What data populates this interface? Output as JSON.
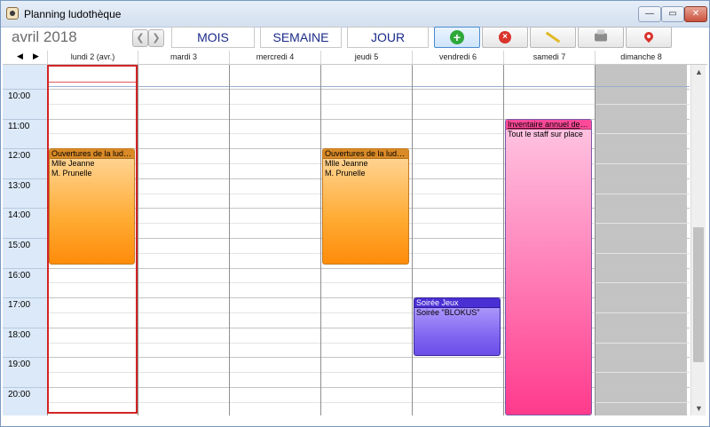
{
  "window": {
    "title": "Planning ludothèque",
    "controls": {
      "minimize": "—",
      "maximize": "▭",
      "close": "✕"
    }
  },
  "toolbar": {
    "month": "avril 2018",
    "prev_label": "❮",
    "next_label": "❯",
    "views": {
      "month": "MOIS",
      "week": "SEMAINE",
      "day": "JOUR"
    },
    "actions": {
      "add": {
        "icon": "add-circle-icon",
        "glyph": "+"
      },
      "delete": {
        "icon": "delete-circle-icon",
        "glyph": "×"
      },
      "edit": {
        "icon": "pencil-icon"
      },
      "print": {
        "icon": "printer-icon"
      },
      "locate": {
        "icon": "map-pin-icon"
      }
    }
  },
  "calendar": {
    "nav": {
      "prev": "◀",
      "next": "▶"
    },
    "days": [
      "lundi 2 (avr.)",
      "mardi 3",
      "mercredi 4",
      "jeudi 5",
      "vendredi 6",
      "samedi 7",
      "dimanche 8"
    ],
    "hours": [
      "10:00",
      "11:00",
      "12:00",
      "13:00",
      "14:00",
      "15:00",
      "16:00",
      "17:00",
      "18:00",
      "19:00",
      "20:00"
    ],
    "today_index": 0,
    "events": [
      {
        "day": 0,
        "start": 12.0,
        "end": 15.9,
        "title": "Ouvertures de la ludot...",
        "lines": [
          "Mlle Jeanne",
          "M. Prunelle"
        ],
        "color": "orange"
      },
      {
        "day": 3,
        "start": 12.0,
        "end": 15.9,
        "title": "Ouvertures de la ludot...",
        "lines": [
          "Mlle Jeanne",
          "M. Prunelle"
        ],
        "color": "orange"
      },
      {
        "day": 4,
        "start": 17.0,
        "end": 18.95,
        "title": "Soirée Jeux",
        "lines": [
          "Soirée \"BLOKUS\""
        ],
        "color": "purple"
      },
      {
        "day": 5,
        "start": 11.0,
        "end": 20.95,
        "title": "Inventaire annuel des ...",
        "lines": [
          "Tout le staff sur place"
        ],
        "color": "pink"
      }
    ]
  },
  "scrollbar": {
    "up": "▲",
    "down": "▼"
  }
}
